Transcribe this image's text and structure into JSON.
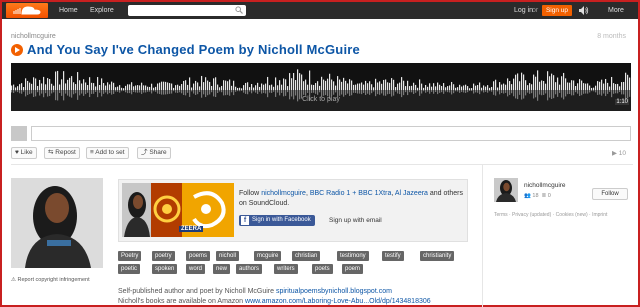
{
  "nav": {
    "home": "Home",
    "explore": "Explore",
    "login": "Log in",
    "or": "or",
    "signup": "Sign up",
    "more": "More"
  },
  "track": {
    "user": "nichollmcguire",
    "time_ago": "8 months",
    "title": "And You Say I've Changed Poem by Nicholl McGuire",
    "click_to_play": "Click to play",
    "duration": "1:10",
    "plays": "10"
  },
  "actions": {
    "like": "Like",
    "repost": "Repost",
    "add_to_set": "Add to set",
    "share": "Share"
  },
  "follow": {
    "prefix": "Follow",
    "user": "nichollmcguire",
    "accounts": "BBC Radio 1 + BBC 1Xtra",
    "al_jazeera": "Al Jazeera",
    "suffix_and": "and",
    "suffix_rest": "others on SoundCloud.",
    "facebook_button": "Sign in with Facebook",
    "email_link": "Sign up with email",
    "image_label": "ZEERA"
  },
  "report": "Report copyright infringement",
  "tags": [
    "Poetry",
    "poetry",
    "poems",
    "nicholl",
    "mcguire",
    "christian",
    "testimony",
    "testify",
    "christianity",
    "poetic",
    "spoken",
    "word",
    "new",
    "authors",
    "writers",
    "poets",
    "poem"
  ],
  "description": {
    "line1_text": "Self-published author and poet by Nicholl McGuire",
    "line1_link": "spiritualpoemsbynicholl.blogspot.com",
    "line2_text": "Nicholl's books are available on Amazon",
    "line2_link": "www.amazon.com/Laboring-Love-Abu...Old/dp/1434818306"
  },
  "sidebar": {
    "name": "nichollmcguire",
    "followers": "18",
    "tracks": "0",
    "follow_button": "Follow",
    "links": "Terms · Privacy (updated) · Cookies (new) · Imprint"
  },
  "colors": {
    "accent": "#f26000",
    "link": "#0d56a6",
    "border": "#c82020"
  }
}
